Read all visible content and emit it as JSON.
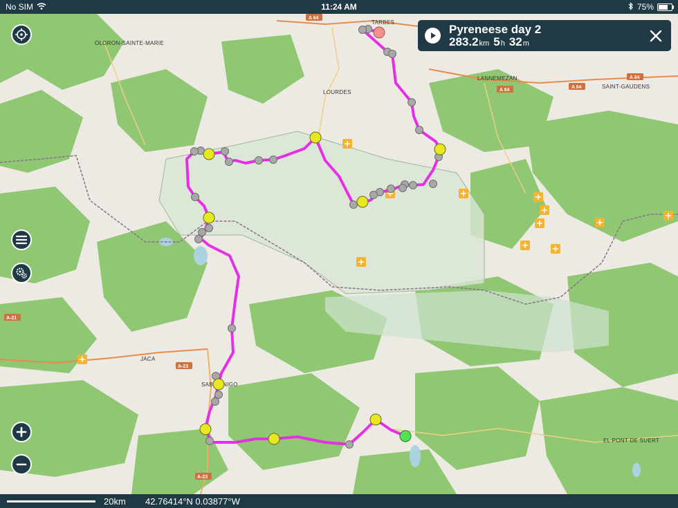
{
  "status_bar": {
    "carrier": "No SIM",
    "time": "11:24 AM",
    "battery": "75%",
    "battery_level": 0.75
  },
  "route_card": {
    "title": "Pyreneese day 2",
    "distance_value": "283.2",
    "distance_unit": "km",
    "hours_value": "5",
    "hours_unit": "h",
    "minutes_value": "32",
    "minutes_unit": "m"
  },
  "map_labels": {
    "tarbes": "TARBES",
    "oloron": "OLORON-SAINTE-MARIE",
    "lourdes": "LOURDES",
    "lannemezan": "LANNEMEZAN",
    "saint_gaudens": "SAINT-GAUDENS",
    "jaca": "JACA",
    "sabinanigo": "SABIÑÁNIGO",
    "pont_de_suert": "EL PONT DE SUERT"
  },
  "road_labels": {
    "a64_top": "A 64",
    "a64_mid": "A 64",
    "a64_right": "A 64",
    "a64_right2": "A 64",
    "a21": "A-21",
    "a23_jaca": "A-23",
    "a23_bottom": "A-23"
  },
  "scale_bar": {
    "label": "20km"
  },
  "coordinates": {
    "text": "42.76414°N 0.03877°W"
  },
  "icons": {
    "locate": "crosshair-icon",
    "menu": "menu-icon",
    "settings": "gears-icon",
    "zoom_in": "plus-icon",
    "zoom_out": "minus-icon",
    "play": "play-icon",
    "close": "close-icon"
  },
  "colors": {
    "chrome": "#1f3a44",
    "route": "#e62ee6",
    "forest": "#8fc773",
    "park": "#d9e6d3",
    "start_marker": "#f49090",
    "end_marker": "#55e055",
    "waypoint": "#e8e820",
    "shaping_point": "#a8a8a8",
    "poi": "#f4b430"
  }
}
